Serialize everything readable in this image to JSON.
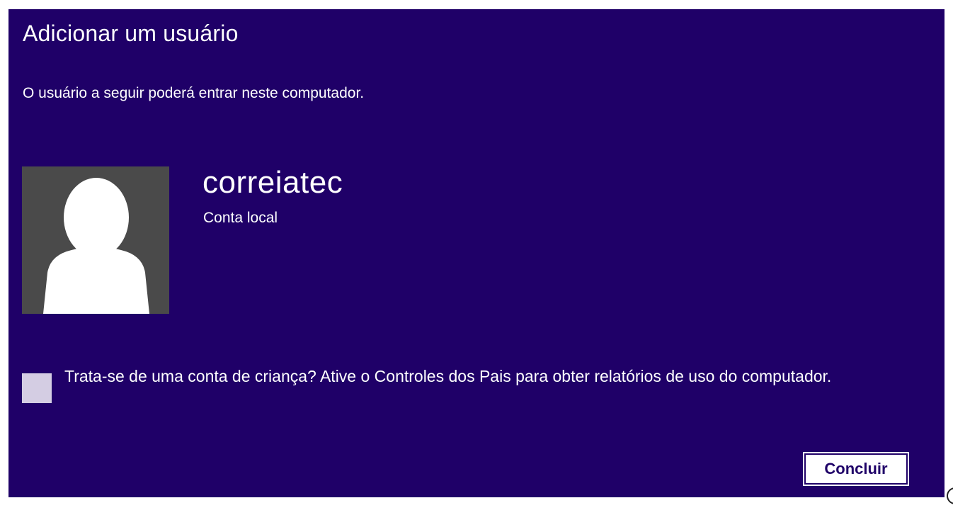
{
  "dialog": {
    "title": "Adicionar um usuário",
    "subtitle": "O usuário a seguir poderá entrar neste computador."
  },
  "user": {
    "name": "correiatec",
    "account_type": "Conta local",
    "avatar_icon": "person-silhouette-icon"
  },
  "parental": {
    "checked": false,
    "label": "Trata-se de uma conta de criança? Ative o Controles dos Pais para obter relatórios de uso do computador."
  },
  "actions": {
    "finish_label": "Concluir"
  },
  "colors": {
    "background": "#1f0068",
    "avatar_bg": "#4a4a4a",
    "checkbox": "#d4cde3",
    "button_text": "#1f0068"
  }
}
